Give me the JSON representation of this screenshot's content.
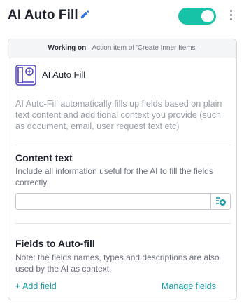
{
  "header": {
    "title": "AI Auto Fill",
    "toggle_on": true,
    "accent_color": "#17c3a6"
  },
  "card": {
    "working_on": {
      "label": "Working on",
      "value": "Action item of 'Create Inner Items'"
    },
    "action": {
      "icon": "ai-auto-fill-icon",
      "name": "AI Auto Fill"
    },
    "description": "AI Auto-Fill automatically fills up fields based on plain text content and additional context you provide (such as document, email, user request text etc)",
    "content_text": {
      "title": "Content text",
      "note": "Include all information useful for the AI to fill the fields correctly",
      "input_value": "",
      "input_placeholder": "",
      "insert_icon": "insert-variable-icon"
    },
    "fields": {
      "title": "Fields to Auto-fill",
      "note": "Note: the fields names, types and descriptions are also used by the AI as context",
      "add_label": "+ Add field",
      "manage_label": "Manage fields"
    }
  },
  "colors": {
    "link": "#1a9ba8",
    "icon_purple": "#4b3fbf",
    "edit_icon": "#2f6fe0"
  }
}
